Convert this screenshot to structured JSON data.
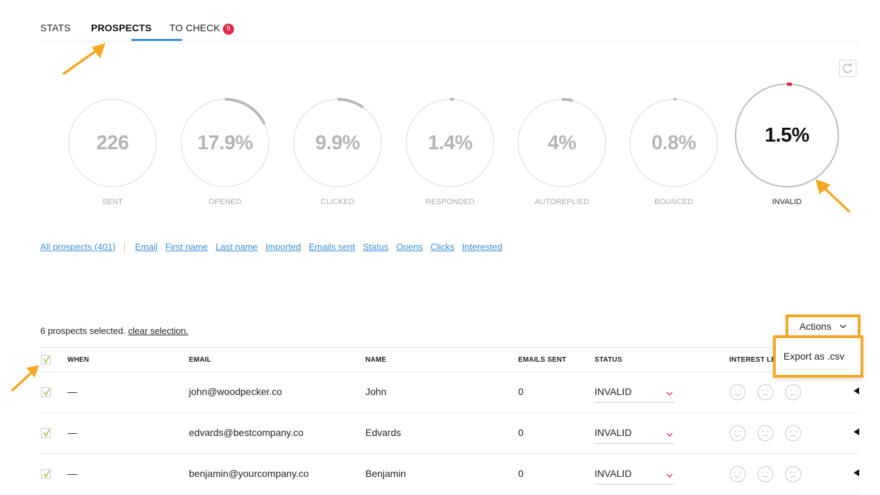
{
  "tabs": [
    {
      "label": "STATS"
    },
    {
      "label": "PROSPECTS"
    },
    {
      "label": "TO CHECK",
      "badge": "9"
    }
  ],
  "stats": [
    {
      "value": "226",
      "label": "SENT",
      "progress": 0
    },
    {
      "value": "17.9%",
      "label": "OPENED",
      "progress": 0.179
    },
    {
      "value": "9.9%",
      "label": "CLICKED",
      "progress": 0.099
    },
    {
      "value": "1.4%",
      "label": "RESPONDED",
      "progress": 0.014
    },
    {
      "value": "4%",
      "label": "AUTOREPLIED",
      "progress": 0.04
    },
    {
      "value": "0.8%",
      "label": "BOUNCED",
      "progress": 0.008
    },
    {
      "value": "1.5%",
      "label": "INVALID",
      "progress": 0.015
    }
  ],
  "filters": {
    "all": "All prospects (401)",
    "items": [
      "Email",
      "First name",
      "Last name",
      "Imported",
      "Emails sent",
      "Status",
      "Opens",
      "Clicks",
      "Interested"
    ]
  },
  "selection": {
    "text": "6 prospects selected.",
    "clear": "clear selection."
  },
  "actions": {
    "label": "Actions",
    "menu_item": "Export as .csv"
  },
  "table": {
    "headers": {
      "when": "WHEN",
      "email": "EMAIL",
      "name": "NAME",
      "emails_sent": "EMAILS SENT",
      "status": "STATUS",
      "interest": "INTEREST LEV"
    },
    "rows": [
      {
        "when": "—",
        "email": "john@woodpecker.co",
        "name": "John",
        "emails_sent": "0",
        "status": "INVALID"
      },
      {
        "when": "—",
        "email": "edvards@bestcompany.co",
        "name": "Edvards",
        "emails_sent": "0",
        "status": "INVALID"
      },
      {
        "when": "—",
        "email": "benjamin@yourcompany.co",
        "name": "Benjamin",
        "emails_sent": "0",
        "status": "INVALID"
      }
    ]
  },
  "colors": {
    "accent": "#3a8fd6",
    "badge": "#e0264a",
    "annotation": "#f5a623",
    "check": "#8cc63f"
  }
}
